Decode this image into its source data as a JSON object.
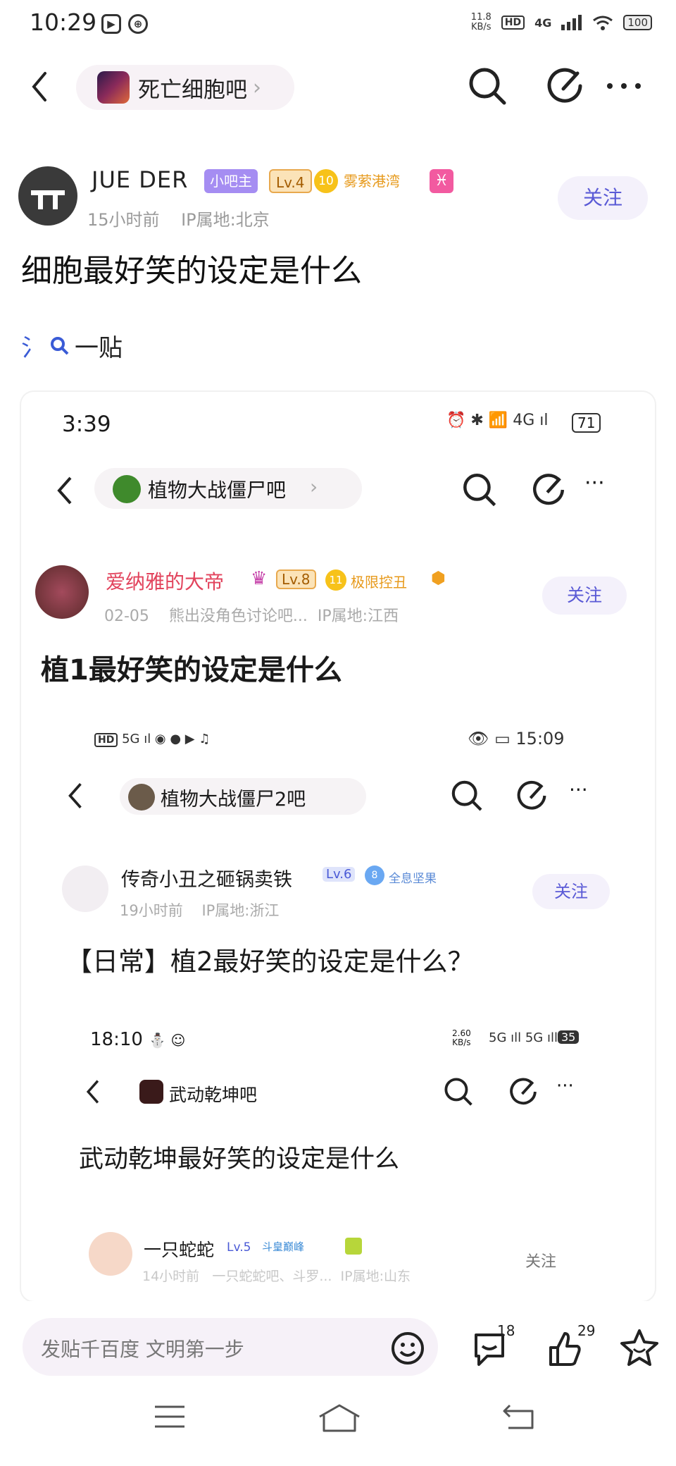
{
  "status": {
    "time": "10:29",
    "net_speed": "11.8\nKB/s",
    "hd": "HD",
    "network": "4G",
    "battery": "100"
  },
  "nav": {
    "forum_name": "死亡细胞吧",
    "chevron": "›"
  },
  "post": {
    "author": "JUE DER",
    "badges": [
      "小吧主",
      "Lv.4",
      "10",
      "雾萦港湾"
    ],
    "time": "15小时前",
    "ip": "IP属地:北京",
    "follow": "关注",
    "title": "细胞最好笑的设定是什么",
    "search_snip": "一贴"
  },
  "embed1": {
    "time": "3:39",
    "battery": "71",
    "forum": "植物大战僵尸吧",
    "author": "爱纳雅的大帝",
    "level": "Lv.8",
    "badge_num": "11",
    "badge": "极限控丑",
    "date": "02-05",
    "source": "熊出没角色讨论吧...",
    "ip": "IP属地:江西",
    "follow": "关注",
    "title": "植1最好笑的设定是什么"
  },
  "embed2": {
    "time": "15:09",
    "hd": "HD",
    "forum": "植物大战僵尸2吧",
    "author": "传奇小丑之砸锅卖铁",
    "level": "Lv.6",
    "badge_num": "8",
    "badge": "全息坚果",
    "date": "19小时前",
    "ip": "IP属地:浙江",
    "follow": "关注",
    "title": "【日常】植2最好笑的设定是什么？"
  },
  "embed3": {
    "time": "18:10",
    "net_speed": "2.60\nKB/s",
    "battery": "35",
    "forum": "武动乾坤吧",
    "title": "武动乾坤最好笑的设定是什么",
    "author": "一只蛇蛇",
    "level": "Lv.5",
    "badge": "斗皇巅峰",
    "date": "14小时前",
    "source": "一只蛇蛇吧、斗罗...",
    "ip": "IP属地:山东",
    "follow": "关注"
  },
  "bottom": {
    "placeholder": "发贴千百度 文明第一步",
    "comments": "18",
    "likes": "29"
  },
  "colors": {
    "accent": "#5a5ad6",
    "badge_purple": "#a58df2",
    "badge_orange": "#f2a94a",
    "follow_bg": "#f4f1fb"
  },
  "icons": [
    "back-icon",
    "search-icon",
    "edit-icon",
    "more-icon",
    "emoji-icon",
    "comment-icon",
    "like-icon",
    "favorite-icon",
    "menu-icon",
    "home-icon",
    "return-icon"
  ]
}
